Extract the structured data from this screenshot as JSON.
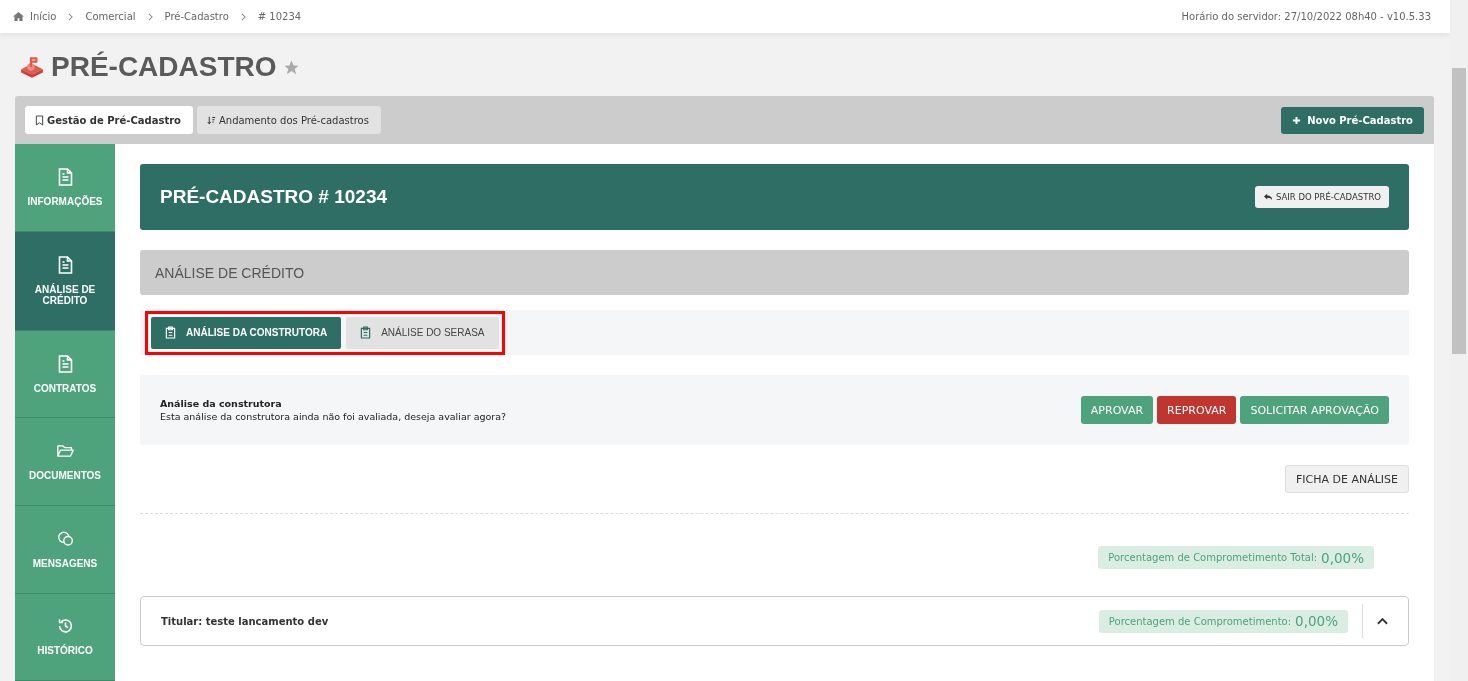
{
  "breadcrumb": [
    {
      "label": "Início"
    },
    {
      "label": "Comercial"
    },
    {
      "label": "Pré-Cadastro"
    },
    {
      "label": "# 10234"
    }
  ],
  "server_time": "Horário do servidor: 27/10/2022 08h40 - v10.5.33",
  "page_title": "PRÉ-CADASTRO",
  "favorite": false,
  "top_tabs": [
    {
      "label": "Gestão de Pré-Cadastro",
      "selected": true
    },
    {
      "label": "Andamento dos Pré-cadastros",
      "selected": false
    }
  ],
  "new_button": "Novo Pré-Cadastro",
  "sidebar": [
    {
      "label": "INFORMAÇÕES",
      "selected": false
    },
    {
      "label": "ANÁLISE DE CRÉDITO",
      "selected": true
    },
    {
      "label": "CONTRATOS",
      "selected": false
    },
    {
      "label": "DOCUMENTOS",
      "selected": false
    },
    {
      "label": "MENSAGENS",
      "selected": false
    },
    {
      "label": "HISTÓRICO",
      "selected": false
    }
  ],
  "header": {
    "title": "PRÉ-CADASTRO # 10234",
    "exit_button": "SAIR DO PRÉ-CADASTRO"
  },
  "section_title": "ANÁLISE DE CRÉDITO",
  "analysis_tabs_highlighted": true,
  "analysis_tabs": [
    {
      "label": "ANÁLISE DA CONSTRUTORA",
      "selected": true
    },
    {
      "label": "ANÁLISE DO SERASA",
      "selected": false
    }
  ],
  "notice": {
    "title": "Análise da construtora",
    "text": "Esta análise da construtora ainda não foi avaliada, deseja avaliar agora?",
    "buttons": [
      {
        "label": "APROVAR",
        "kind": "approve"
      },
      {
        "label": "REPROVAR",
        "kind": "reject"
      },
      {
        "label": "SOLICITAR APROVAÇÃO",
        "kind": "approve"
      }
    ]
  },
  "sheet_button": "FICHA DE ANÁLISE",
  "total_commitment": {
    "label": "Porcentagem de Comprometimento Total:",
    "value": "0,00%"
  },
  "holder": {
    "title": "Titular: teste lancamento dev",
    "label": "Porcentagem de Comprometimento:",
    "value": "0,00%",
    "expanded": true
  }
}
